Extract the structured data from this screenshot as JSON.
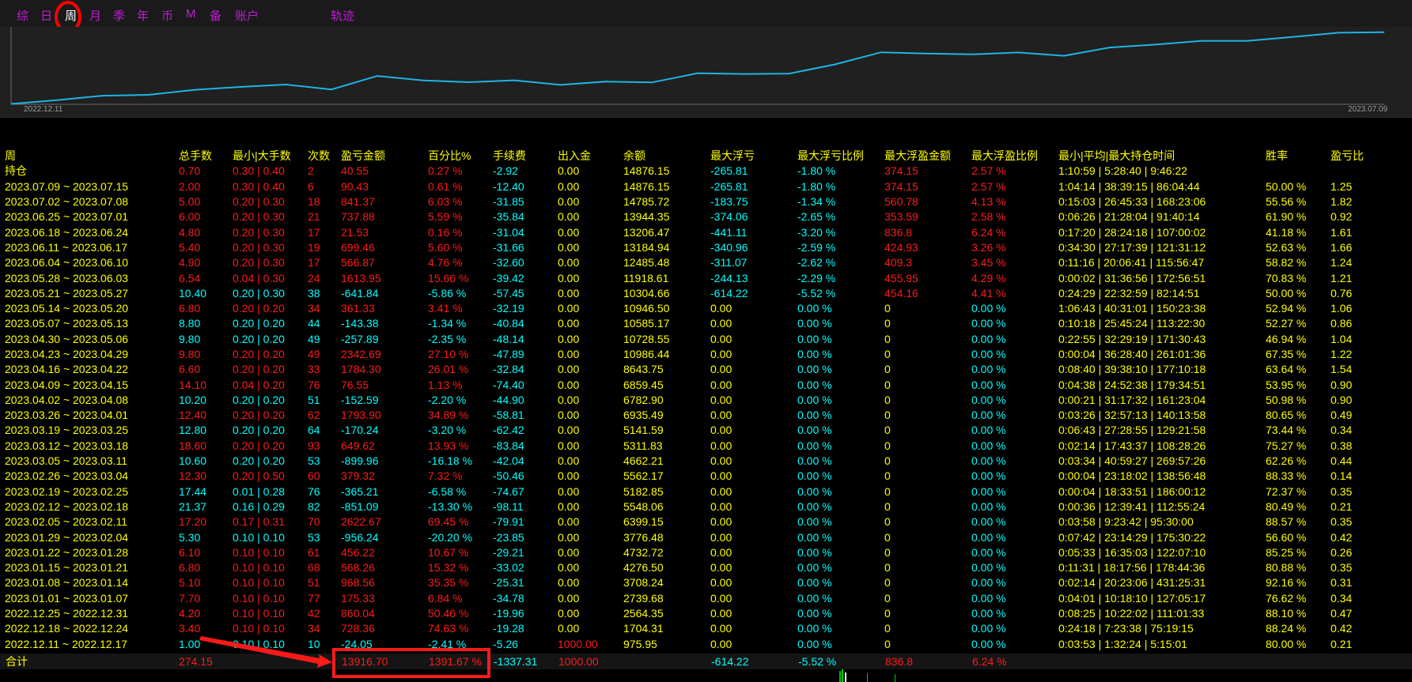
{
  "tabs": [
    {
      "label": "综",
      "active": false
    },
    {
      "label": "日",
      "active": false
    },
    {
      "label": "周",
      "active": true
    },
    {
      "label": "月",
      "active": false
    },
    {
      "label": "季",
      "active": false
    },
    {
      "label": "年",
      "active": false
    },
    {
      "label": "币",
      "active": false
    },
    {
      "label": "M",
      "active": false
    },
    {
      "label": "备",
      "active": false
    },
    {
      "label": "账户",
      "active": false
    },
    {
      "label": "轨迹",
      "active": false
    }
  ],
  "chart_data": {
    "type": "line",
    "x_start_label": "2022.12.11",
    "x_end_label": "2023.07.09",
    "series": [
      {
        "values": [
          975.95,
          1704.31,
          2564.35,
          2739.68,
          3708.24,
          4276.5,
          4732.72,
          3776.48,
          6399.15,
          5548.06,
          5182.85,
          5562.17,
          4662.21,
          5311.83,
          5141.59,
          6935.49,
          6782.9,
          6859.45,
          8643.75,
          10986.44,
          10728.55,
          10585.17,
          10946.5,
          10304.66,
          11918.61,
          12485.48,
          13184.94,
          13206.47,
          13944.35,
          14785.72,
          14876.15
        ]
      }
    ],
    "line_color": "#1eb4e6"
  },
  "columns": [
    "周",
    "总手数",
    "最小|大手数",
    "次数",
    "盈亏金额",
    "百分比%",
    "手续费",
    "出入金",
    "余额",
    "最大浮亏",
    "最大浮亏比例",
    "最大浮盈金额",
    "最大浮盈比例",
    "最小|平均|最大持仓时间",
    "胜率",
    "盈亏比"
  ],
  "rows": [
    {
      "tone": "red",
      "cells": [
        "持仓",
        "0.70",
        "0.30 | 0.40",
        "2",
        "40.55",
        "0.27 %",
        "-2.92",
        "0.00",
        "14876.15",
        "-265.81",
        "-1.80 %",
        "374.15",
        "2.57 %",
        "1:10:59 | 5:28:40 | 9:46:22",
        "",
        ""
      ]
    },
    {
      "tone": "red",
      "cells": [
        "2023.07.09 ~ 2023.07.15",
        "2.00",
        "0.30 | 0.40",
        "6",
        "90.43",
        "0.61 %",
        "-12.40",
        "0.00",
        "14876.15",
        "-265.81",
        "-1.80 %",
        "374.15",
        "2.57 %",
        "1:04:14 | 38:39:15 | 86:04:44",
        "50.00 %",
        "1.25"
      ]
    },
    {
      "tone": "red",
      "cells": [
        "2023.07.02 ~ 2023.07.08",
        "5.00",
        "0.20 | 0.30",
        "18",
        "841.37",
        "6.03 %",
        "-31.85",
        "0.00",
        "14785.72",
        "-183.75",
        "-1.34 %",
        "560.78",
        "4.13 %",
        "0:15:03 | 26:45:33 | 168:23:06",
        "55.56 %",
        "1.82"
      ]
    },
    {
      "tone": "red",
      "cells": [
        "2023.06.25 ~ 2023.07.01",
        "6.00",
        "0.20 | 0.30",
        "21",
        "737.88",
        "5.59 %",
        "-35.84",
        "0.00",
        "13944.35",
        "-374.06",
        "-2.65 %",
        "353.59",
        "2.58 %",
        "0:06:26 | 21:28:04 | 91:40:14",
        "61.90 %",
        "0.92"
      ]
    },
    {
      "tone": "red",
      "cells": [
        "2023.06.18 ~ 2023.06.24",
        "4.80",
        "0.20 | 0.30",
        "17",
        "21.53",
        "0.16 %",
        "-31.04",
        "0.00",
        "13206.47",
        "-441.11",
        "-3.20 %",
        "836.8",
        "6.24 %",
        "0:17:20 | 28:24:18 | 107:00:02",
        "41.18 %",
        "1.61"
      ]
    },
    {
      "tone": "red",
      "cells": [
        "2023.06.11 ~ 2023.06.17",
        "5.40",
        "0.20 | 0.30",
        "19",
        "699.46",
        "5.60 %",
        "-31.66",
        "0.00",
        "13184.94",
        "-340.96",
        "-2.59 %",
        "424.93",
        "3.26 %",
        "0:34:30 | 27:17:39 | 121:31:12",
        "52.63 %",
        "1.66"
      ]
    },
    {
      "tone": "red",
      "cells": [
        "2023.06.04 ~ 2023.06.10",
        "4.90",
        "0.20 | 0.30",
        "17",
        "566.87",
        "4.76 %",
        "-32.60",
        "0.00",
        "12485.48",
        "-311.07",
        "-2.62 %",
        "409.3",
        "3.45 %",
        "0:11:16 | 20:06:41 | 115:56:47",
        "58.82 %",
        "1.24"
      ]
    },
    {
      "tone": "red",
      "cells": [
        "2023.05.28 ~ 2023.06.03",
        "6.54",
        "0.04 | 0.30",
        "24",
        "1613.95",
        "15.66 %",
        "-39.42",
        "0.00",
        "11918.61",
        "-244.13",
        "-2.29 %",
        "455.95",
        "4.29 %",
        "0:00:02 | 31:36:56 | 172:56:51",
        "70.83 %",
        "1.21"
      ]
    },
    {
      "tone": "cyan",
      "cells": [
        "2023.05.21 ~ 2023.05.27",
        "10.40",
        "0.20 | 0.30",
        "38",
        "-641.84",
        "-5.86 %",
        "-57.45",
        "0.00",
        "10304.66",
        "-614.22",
        "-5.52 %",
        "454.16",
        "4.41 %",
        "0:24:29 | 22:32:59 | 82:14:51",
        "50.00 %",
        "0.76"
      ]
    },
    {
      "tone": "red",
      "cells": [
        "2023.05.14 ~ 2023.05.20",
        "6.80",
        "0.20 | 0.20",
        "34",
        "361.33",
        "3.41 %",
        "-32.19",
        "0.00",
        "10946.50",
        "0.00",
        "0.00 %",
        "0",
        "0.00 %",
        "1:06:43 | 40:31:01 | 150:23:38",
        "52.94 %",
        "1.06"
      ]
    },
    {
      "tone": "cyan",
      "cells": [
        "2023.05.07 ~ 2023.05.13",
        "8.80",
        "0.20 | 0.20",
        "44",
        "-143.38",
        "-1.34 %",
        "-40.84",
        "0.00",
        "10585.17",
        "0.00",
        "0.00 %",
        "0",
        "0.00 %",
        "0:10:18 | 25:45:24 | 113:22:30",
        "52.27 %",
        "0.86"
      ]
    },
    {
      "tone": "cyan",
      "cells": [
        "2023.04.30 ~ 2023.05.06",
        "9.80",
        "0.20 | 0.20",
        "49",
        "-257.89",
        "-2.35 %",
        "-48.14",
        "0.00",
        "10728.55",
        "0.00",
        "0.00 %",
        "0",
        "0.00 %",
        "0:22:55 | 32:29:19 | 171:30:43",
        "46.94 %",
        "1.04"
      ]
    },
    {
      "tone": "red",
      "cells": [
        "2023.04.23 ~ 2023.04.29",
        "9.80",
        "0.20 | 0.20",
        "49",
        "2342.69",
        "27.10 %",
        "-47.89",
        "0.00",
        "10986.44",
        "0.00",
        "0.00 %",
        "0",
        "0.00 %",
        "0:00:04 | 36:28:40 | 261:01:36",
        "67.35 %",
        "1.22"
      ]
    },
    {
      "tone": "red",
      "cells": [
        "2023.04.16 ~ 2023.04.22",
        "6.60",
        "0.20 | 0.20",
        "33",
        "1784.30",
        "26.01 %",
        "-32.84",
        "0.00",
        "8643.75",
        "0.00",
        "0.00 %",
        "0",
        "0.00 %",
        "0:08:40 | 39:38:10 | 177:10:18",
        "63.64 %",
        "1.54"
      ]
    },
    {
      "tone": "red",
      "cells": [
        "2023.04.09 ~ 2023.04.15",
        "14.10",
        "0.04 | 0.20",
        "76",
        "76.55",
        "1.13 %",
        "-74.40",
        "0.00",
        "6859.45",
        "0.00",
        "0.00 %",
        "0",
        "0.00 %",
        "0:04:38 | 24:52:38 | 179:34:51",
        "53.95 %",
        "0.90"
      ]
    },
    {
      "tone": "cyan",
      "cells": [
        "2023.04.02 ~ 2023.04.08",
        "10.20",
        "0.20 | 0.20",
        "51",
        "-152.59",
        "-2.20 %",
        "-44.90",
        "0.00",
        "6782.90",
        "0.00",
        "0.00 %",
        "0",
        "0.00 %",
        "0:00:21 | 31:17:32 | 161:23:04",
        "50.98 %",
        "0.90"
      ]
    },
    {
      "tone": "red",
      "cells": [
        "2023.03.26 ~ 2023.04.01",
        "12.40",
        "0.20 | 0.20",
        "62",
        "1793.90",
        "34.89 %",
        "-58.81",
        "0.00",
        "6935.49",
        "0.00",
        "0.00 %",
        "0",
        "0.00 %",
        "0:03:26 | 32:57:13 | 140:13:58",
        "80.65 %",
        "0.49"
      ]
    },
    {
      "tone": "cyan",
      "cells": [
        "2023.03.19 ~ 2023.03.25",
        "12.80",
        "0.20 | 0.20",
        "64",
        "-170.24",
        "-3.20 %",
        "-62.42",
        "0.00",
        "5141.59",
        "0.00",
        "0.00 %",
        "0",
        "0.00 %",
        "0:06:43 | 27:28:55 | 129:21:58",
        "73.44 %",
        "0.34"
      ]
    },
    {
      "tone": "red",
      "cells": [
        "2023.03.12 ~ 2023.03.18",
        "18.60",
        "0.20 | 0.20",
        "93",
        "649.62",
        "13.93 %",
        "-83.84",
        "0.00",
        "5311.83",
        "0.00",
        "0.00 %",
        "0",
        "0.00 %",
        "0:02:14 | 17:43:37 | 108:28:26",
        "75.27 %",
        "0.38"
      ]
    },
    {
      "tone": "cyan",
      "cells": [
        "2023.03.05 ~ 2023.03.11",
        "10.60",
        "0.20 | 0.20",
        "53",
        "-899.96",
        "-16.18 %",
        "-42.04",
        "0.00",
        "4662.21",
        "0.00",
        "0.00 %",
        "0",
        "0.00 %",
        "0:03:34 | 40:59:27 | 269:57:26",
        "62.26 %",
        "0.44"
      ]
    },
    {
      "tone": "red",
      "cells": [
        "2023.02.26 ~ 2023.03.04",
        "12.30",
        "0.20 | 0.50",
        "60",
        "379.32",
        "7.32 %",
        "-50.46",
        "0.00",
        "5562.17",
        "0.00",
        "0.00 %",
        "0",
        "0.00 %",
        "0:00:04 | 23:18:02 | 138:56:48",
        "88.33 %",
        "0.14"
      ]
    },
    {
      "tone": "cyan",
      "cells": [
        "2023.02.19 ~ 2023.02.25",
        "17.44",
        "0.01 | 0.28",
        "76",
        "-365.21",
        "-6.58 %",
        "-74.67",
        "0.00",
        "5182.85",
        "0.00",
        "0.00 %",
        "0",
        "0.00 %",
        "0:00:04 | 18:33:51 | 186:00:12",
        "72.37 %",
        "0.35"
      ]
    },
    {
      "tone": "cyan",
      "cells": [
        "2023.02.12 ~ 2023.02.18",
        "21.37",
        "0.16 | 0.29",
        "82",
        "-851.09",
        "-13.30 %",
        "-98.11",
        "0.00",
        "5548.06",
        "0.00",
        "0.00 %",
        "0",
        "0.00 %",
        "0:00:36 | 12:39:41 | 112:55:24",
        "80.49 %",
        "0.21"
      ]
    },
    {
      "tone": "red",
      "cells": [
        "2023.02.05 ~ 2023.02.11",
        "17.20",
        "0.17 | 0.31",
        "70",
        "2622.67",
        "69.45 %",
        "-79.91",
        "0.00",
        "6399.15",
        "0.00",
        "0.00 %",
        "0",
        "0.00 %",
        "0:03:58 | 9:23:42 | 95:30:00",
        "88.57 %",
        "0.35"
      ]
    },
    {
      "tone": "cyan",
      "cells": [
        "2023.01.29 ~ 2023.02.04",
        "5.30",
        "0.10 | 0.10",
        "53",
        "-956.24",
        "-20.20 %",
        "-23.85",
        "0.00",
        "3776.48",
        "0.00",
        "0.00 %",
        "0",
        "0.00 %",
        "0:07:42 | 23:14:29 | 175:30:22",
        "56.60 %",
        "0.42"
      ]
    },
    {
      "tone": "red",
      "cells": [
        "2023.01.22 ~ 2023.01.28",
        "6.10",
        "0.10 | 0.10",
        "61",
        "456.22",
        "10.67 %",
        "-29.21",
        "0.00",
        "4732.72",
        "0.00",
        "0.00 %",
        "0",
        "0.00 %",
        "0:05:33 | 16:35:03 | 122:07:10",
        "85.25 %",
        "0.26"
      ]
    },
    {
      "tone": "red",
      "cells": [
        "2023.01.15 ~ 2023.01.21",
        "6.80",
        "0.10 | 0.10",
        "68",
        "568.26",
        "15.32 %",
        "-33.02",
        "0.00",
        "4276.50",
        "0.00",
        "0.00 %",
        "0",
        "0.00 %",
        "0:11:31 | 18:17:56 | 178:44:36",
        "80.88 %",
        "0.35"
      ]
    },
    {
      "tone": "red",
      "cells": [
        "2023.01.08 ~ 2023.01.14",
        "5.10",
        "0.10 | 0.10",
        "51",
        "968.56",
        "35.35 %",
        "-25.31",
        "0.00",
        "3708.24",
        "0.00",
        "0.00 %",
        "0",
        "0.00 %",
        "0:02:14 | 20:23:06 | 431:25:31",
        "92.16 %",
        "0.31"
      ]
    },
    {
      "tone": "red",
      "cells": [
        "2023.01.01 ~ 2023.01.07",
        "7.70",
        "0.10 | 0.10",
        "77",
        "175.33",
        "6.84 %",
        "-34.78",
        "0.00",
        "2739.68",
        "0.00",
        "0.00 %",
        "0",
        "0.00 %",
        "0:04:01 | 10:18:10 | 127:05:17",
        "76.62 %",
        "0.34"
      ]
    },
    {
      "tone": "red",
      "cells": [
        "2022.12.25 ~ 2022.12.31",
        "4.20",
        "0.10 | 0.10",
        "42",
        "860.04",
        "50.46 %",
        "-19.96",
        "0.00",
        "2564.35",
        "0.00",
        "0.00 %",
        "0",
        "0.00 %",
        "0:08:25 | 10:22:02 | 111:01:33",
        "88.10 %",
        "0.47"
      ]
    },
    {
      "tone": "red",
      "cells": [
        "2022.12.18 ~ 2022.12.24",
        "3.40",
        "0.10 | 0.10",
        "34",
        "728.36",
        "74.63 %",
        "-19.28",
        "0.00",
        "1704.31",
        "0.00",
        "0.00 %",
        "0",
        "0.00 %",
        "0:24:18 | 7:23:38 | 75:19:15",
        "88.24 %",
        "0.42"
      ]
    },
    {
      "tone": "cyan",
      "cells": [
        "2022.12.11 ~ 2022.12.17",
        "1.00",
        "0.10 | 0.10",
        "10",
        "-24.05",
        "-2.41 %",
        "-5.26",
        "1000.00",
        "975.95",
        "0.00",
        "0.00 %",
        "0",
        "0.00 %",
        "0:03:53 | 1:32:24 | 5:15:01",
        "80.00 %",
        "0.21"
      ]
    }
  ],
  "totals": {
    "label": "合计",
    "lots": "274.15",
    "pnl": "13916.70",
    "percent": "1391.67 %",
    "fee": "-1337.31",
    "deposit": "1000.00",
    "max_float_loss": "-614.22",
    "max_float_loss_pct": "-5.52 %",
    "max_float_profit": "836.8",
    "max_float_profit_pct": "6.24 %"
  }
}
